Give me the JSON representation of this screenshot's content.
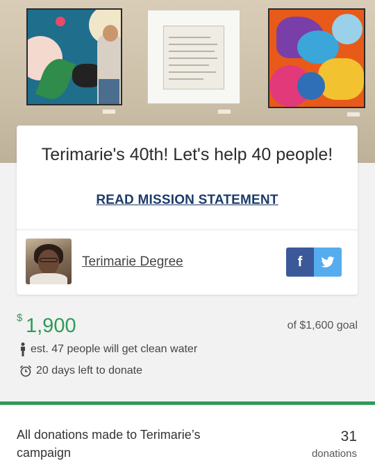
{
  "campaign": {
    "title": "Terimarie's 40th! Let's help 40 people!",
    "mission_link": "READ MISSION STATEMENT",
    "organizer": "Terimarie Degree"
  },
  "share": {
    "facebook_label": "f"
  },
  "stats": {
    "currency_symbol": "$",
    "raised": "1,900",
    "goal_text": "of $1,600 goal",
    "people_text": "est. 47 people will get clean water",
    "days_text": "20 days left to donate",
    "progress_fraction": 1.0
  },
  "donations": {
    "description": "All donations made to Terimarie’s campaign",
    "count": "31",
    "count_label": "donations"
  },
  "colors": {
    "accent_green": "#2f9a57",
    "mission_blue": "#1c3b6b",
    "facebook": "#3b5998",
    "twitter": "#55acee"
  },
  "icons": [
    "person-icon",
    "alarm-clock-icon",
    "facebook-icon",
    "twitter-icon"
  ]
}
